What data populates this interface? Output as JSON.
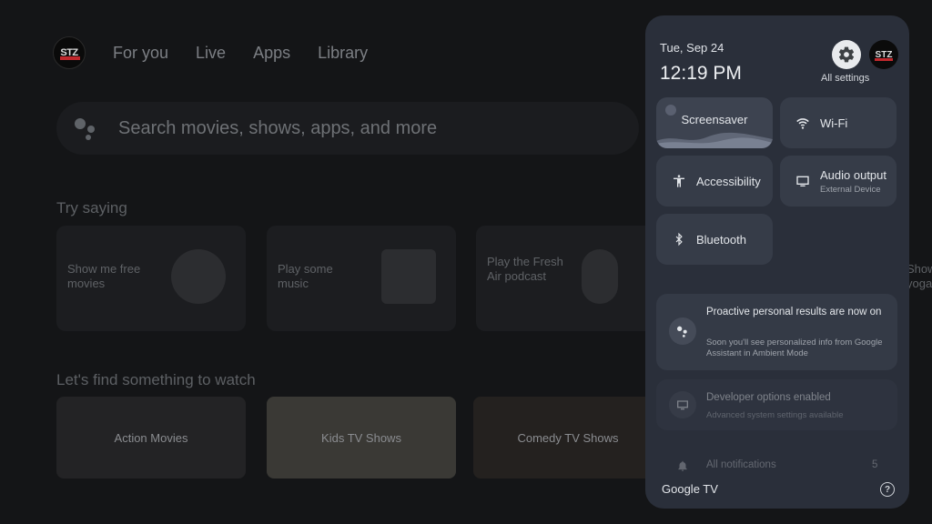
{
  "home": {
    "profile_text": "STZ",
    "nav": [
      "For you",
      "Live",
      "Apps",
      "Library"
    ],
    "search_placeholder": "Search movies, shows, apps, and more",
    "try_saying_title": "Try saying",
    "suggestions": [
      {
        "text": "Show me free movies",
        "icon": "film-reel-icon"
      },
      {
        "text": "Play some music",
        "icon": "record-player-icon"
      },
      {
        "text": "Play the Fresh Air podcast",
        "icon": "microphone-icon"
      }
    ],
    "edge_text": "Show yoga",
    "watch_title": "Let's find something to watch",
    "media": [
      "Action Movies",
      "Kids TV Shows",
      "Comedy TV Shows"
    ]
  },
  "panel": {
    "date": "Tue, Sep 24",
    "time": "12:19 PM",
    "settings_label": "All settings",
    "avatar_text": "STZ",
    "tiles": {
      "screensaver": "Screensaver",
      "wifi": "Wi-Fi",
      "accessibility": "Accessibility",
      "audio_output": "Audio output",
      "audio_output_sub": "External Device",
      "bluetooth": "Bluetooth"
    },
    "notifications": [
      {
        "title": "Proactive personal results are now on",
        "body": "Soon you'll see personalized info from Google Assistant in Ambient Mode"
      },
      {
        "title": "Developer options enabled",
        "body": "Advanced system settings available"
      },
      {
        "title": "All notifications",
        "count": "5"
      }
    ],
    "brand": "Google TV",
    "help": "?"
  },
  "colors": {
    "panel_bg": "#2a2f3a",
    "tile_bg": "#363c48",
    "home_bg": "#141517"
  }
}
